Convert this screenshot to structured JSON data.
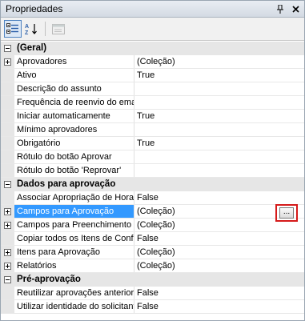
{
  "window": {
    "title": "Propriedades"
  },
  "icons": {
    "pin": "pin-icon",
    "close": "close-icon",
    "categorized": "categorized-view-icon",
    "alphabetical": "sort-alphabetical-icon",
    "property_pages": "property-pages-icon"
  },
  "colors": {
    "selection": "#3399ff",
    "highlight_border": "#d51a1a"
  },
  "categories": [
    {
      "name": "(Geral)",
      "rows": [
        {
          "name": "Aprovadores",
          "value": "(Coleção)",
          "expandable": true
        },
        {
          "name": "Ativo",
          "value": "True"
        },
        {
          "name": "Descrição do assunto",
          "value": ""
        },
        {
          "name": "Frequência de reenvio do ema",
          "value": ""
        },
        {
          "name": "Iniciar automaticamente",
          "value": "True"
        },
        {
          "name": "Mínimo aprovadores",
          "value": ""
        },
        {
          "name": "Obrigatório",
          "value": "True"
        },
        {
          "name": "Rótulo do botão Aprovar",
          "value": ""
        },
        {
          "name": "Rótulo do botão 'Reprovar'",
          "value": ""
        }
      ]
    },
    {
      "name": "Dados para aprovação",
      "rows": [
        {
          "name": "Associar Apropriação de Horas",
          "value": "False"
        },
        {
          "name": "Campos para Aprovação",
          "value": "(Coleção)",
          "expandable": true,
          "selected": true,
          "ellipsis": "..."
        },
        {
          "name": "Campos para Preenchimento",
          "value": "(Coleção)",
          "expandable": true
        },
        {
          "name": "Copiar todos os Itens de Conf",
          "value": "False"
        },
        {
          "name": "Itens para Aprovação",
          "value": "(Coleção)",
          "expandable": true
        },
        {
          "name": "Relatórios",
          "value": "(Coleção)",
          "expandable": true
        }
      ]
    },
    {
      "name": "Pré-aprovação",
      "rows": [
        {
          "name": "Reutilizar aprovações anterior",
          "value": "False"
        },
        {
          "name": "Utilizar identidade do solicitant",
          "value": "False"
        }
      ]
    }
  ]
}
